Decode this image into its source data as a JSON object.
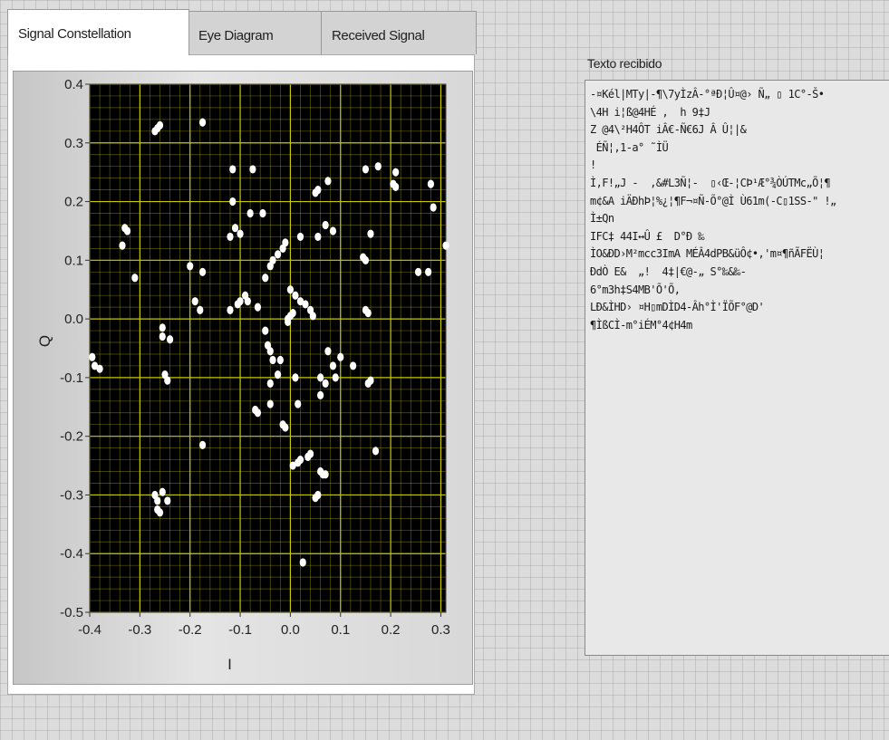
{
  "tabs": [
    {
      "label": "Signal Constellation",
      "active": true
    },
    {
      "label": "Eye Diagram",
      "active": false
    },
    {
      "label": "Received Signal",
      "active": false
    }
  ],
  "text_display": {
    "label": "Texto recibido",
    "lines": [
      "-¤Kél|MTy|-¶\\7yÌzÂ-°ªÐ¦Û¤@› Ñ„ ▯ 1C°-Š•",
      "\\4H i¦ß@4HÉ ,  h 9‡J",
      "Z @4\\²H4ÔT iÂ€-Ñ€6J Â Û¦|&",
      " ÉÑ¦,1-a° ˜ÌÜ",
      "!",
      "Ì,F!„J -  ,&#L3Ñ¦-  ▯‹Œ-¦CÞ¹Æ°¾ÒÚTMc„Õ¦¶",
      "m¢&A iÄÐhÞ¦%¿¦¶F¬¤Ñ-Õ°@Ì Ù61m(-C▯1SS-\" !„",
      "Ì±Qn",
      "IFC‡ 44I↔Û £  D°Ð ‰",
      "ÌO&ÐD›M²mcc3ImA MÉÂ4dPB&üÔ¢•,'m¤¶ñÃFËÙ¦",
      "ÐdÒ E&  „!  4‡|€@-„ S°‰&‰-",
      "6°m3h‡S4MB'Õ'Õ,",
      "LÐ&ÌHD› ¤H▯mDÌD4-Âh°Ì'ЇÕF°@D'",
      "¶ÌßCÌ-m°iÉM°4¢H4m"
    ]
  },
  "chart_data": {
    "type": "scatter",
    "xlabel": "I",
    "ylabel": "Q",
    "xlim": [
      -0.4,
      0.31
    ],
    "ylim": [
      -0.5,
      0.4
    ],
    "xticks": [
      "-0.4",
      "-0.3",
      "-0.2",
      "-0.1",
      "0.0",
      "0.1",
      "0.2",
      "0.3"
    ],
    "yticks": [
      "0.4",
      "0.3",
      "0.2",
      "0.1",
      "0.0",
      "-0.1",
      "-0.2",
      "-0.3",
      "-0.4",
      "-0.5"
    ],
    "colors": {
      "plot_bg": "#000000",
      "grid": "#c8c800",
      "points": "#ffffff"
    },
    "grid": true,
    "points": [
      [
        -0.27,
        0.32
      ],
      [
        -0.265,
        0.325
      ],
      [
        -0.26,
        0.33
      ],
      [
        -0.175,
        0.335
      ],
      [
        -0.115,
        0.255
      ],
      [
        -0.075,
        0.255
      ],
      [
        -0.115,
        0.2
      ],
      [
        -0.08,
        0.18
      ],
      [
        -0.055,
        0.18
      ],
      [
        -0.11,
        0.155
      ],
      [
        -0.12,
        0.14
      ],
      [
        -0.1,
        0.145
      ],
      [
        -0.33,
        0.155
      ],
      [
        -0.325,
        0.15
      ],
      [
        -0.335,
        0.125
      ],
      [
        -0.31,
        0.07
      ],
      [
        -0.2,
        0.09
      ],
      [
        -0.175,
        0.08
      ],
      [
        -0.19,
        0.03
      ],
      [
        -0.18,
        0.015
      ],
      [
        -0.12,
        0.015
      ],
      [
        -0.105,
        0.025
      ],
      [
        -0.1,
        0.03
      ],
      [
        -0.09,
        0.04
      ],
      [
        -0.085,
        0.03
      ],
      [
        -0.065,
        0.02
      ],
      [
        -0.05,
        0.07
      ],
      [
        -0.04,
        0.09
      ],
      [
        -0.035,
        0.1
      ],
      [
        -0.025,
        0.11
      ],
      [
        -0.015,
        0.12
      ],
      [
        -0.01,
        0.13
      ],
      [
        0.02,
        0.14
      ],
      [
        0.055,
        0.14
      ],
      [
        0.07,
        0.16
      ],
      [
        0.085,
        0.15
      ],
      [
        0.05,
        0.215
      ],
      [
        0.055,
        0.22
      ],
      [
        0.075,
        0.235
      ],
      [
        0.15,
        0.255
      ],
      [
        0.175,
        0.26
      ],
      [
        0.21,
        0.25
      ],
      [
        0.205,
        0.23
      ],
      [
        0.21,
        0.225
      ],
      [
        0.28,
        0.23
      ],
      [
        0.285,
        0.19
      ],
      [
        0.145,
        0.105
      ],
      [
        0.15,
        0.1
      ],
      [
        0.16,
        0.145
      ],
      [
        0.255,
        0.08
      ],
      [
        0.275,
        0.08
      ],
      [
        0.31,
        0.125
      ],
      [
        0.0,
        0.05
      ],
      [
        0.01,
        0.04
      ],
      [
        0.02,
        0.03
      ],
      [
        0.03,
        0.025
      ],
      [
        0.04,
        0.015
      ],
      [
        0.045,
        0.005
      ],
      [
        -0.005,
        0.0
      ],
      [
        0.0,
        0.005
      ],
      [
        0.005,
        0.01
      ],
      [
        -0.005,
        -0.005
      ],
      [
        0.15,
        0.015
      ],
      [
        0.155,
        0.01
      ],
      [
        -0.05,
        -0.02
      ],
      [
        -0.045,
        -0.045
      ],
      [
        -0.04,
        -0.055
      ],
      [
        -0.035,
        -0.07
      ],
      [
        -0.02,
        -0.07
      ],
      [
        -0.04,
        -0.11
      ],
      [
        -0.025,
        -0.095
      ],
      [
        0.06,
        -0.1
      ],
      [
        0.07,
        -0.11
      ],
      [
        0.01,
        -0.1
      ],
      [
        0.075,
        -0.055
      ],
      [
        0.085,
        -0.08
      ],
      [
        0.1,
        -0.065
      ],
      [
        0.125,
        -0.08
      ],
      [
        0.09,
        -0.1
      ],
      [
        0.155,
        -0.11
      ],
      [
        0.16,
        -0.105
      ],
      [
        -0.395,
        -0.065
      ],
      [
        -0.39,
        -0.08
      ],
      [
        -0.38,
        -0.085
      ],
      [
        -0.255,
        -0.015
      ],
      [
        -0.255,
        -0.03
      ],
      [
        -0.24,
        -0.035
      ],
      [
        -0.25,
        -0.095
      ],
      [
        -0.245,
        -0.105
      ],
      [
        -0.04,
        -0.145
      ],
      [
        -0.07,
        -0.155
      ],
      [
        -0.065,
        -0.16
      ],
      [
        -0.015,
        -0.18
      ],
      [
        -0.01,
        -0.185
      ],
      [
        0.015,
        -0.145
      ],
      [
        0.06,
        -0.13
      ],
      [
        -0.175,
        -0.215
      ],
      [
        0.17,
        -0.225
      ],
      [
        0.035,
        -0.235
      ],
      [
        0.04,
        -0.23
      ],
      [
        0.02,
        -0.24
      ],
      [
        0.015,
        -0.245
      ],
      [
        0.005,
        -0.25
      ],
      [
        0.06,
        -0.26
      ],
      [
        0.065,
        -0.265
      ],
      [
        0.07,
        -0.265
      ],
      [
        0.055,
        -0.3
      ],
      [
        0.05,
        -0.305
      ],
      [
        -0.27,
        -0.3
      ],
      [
        -0.265,
        -0.31
      ],
      [
        -0.255,
        -0.295
      ],
      [
        -0.245,
        -0.31
      ],
      [
        -0.265,
        -0.325
      ],
      [
        -0.26,
        -0.33
      ],
      [
        0.025,
        -0.415
      ]
    ]
  }
}
